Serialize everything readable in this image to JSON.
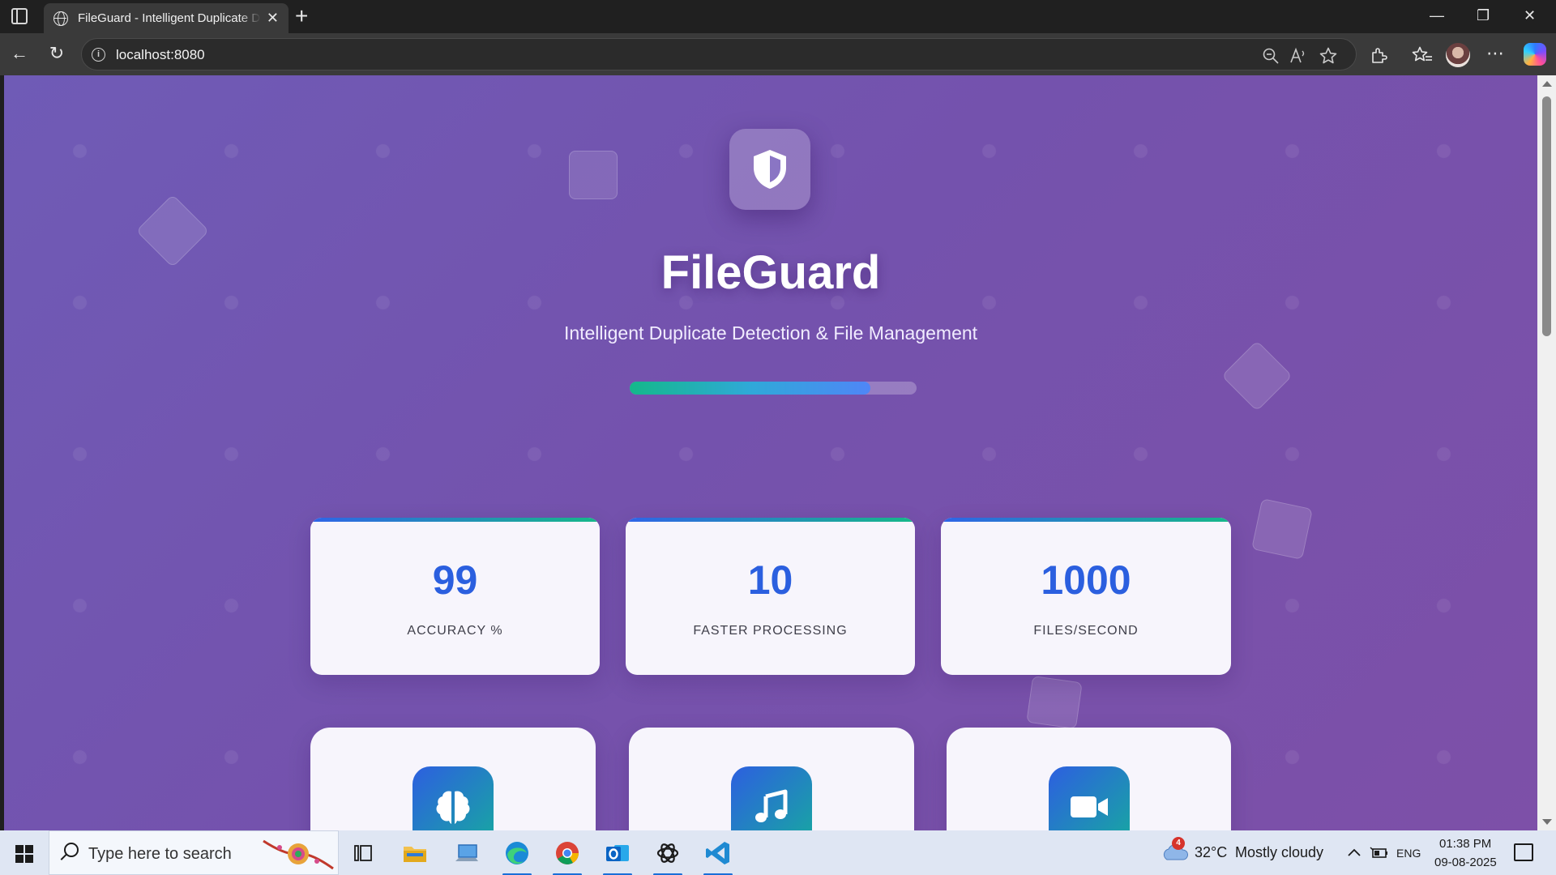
{
  "browser": {
    "tab_title": "FileGuard - Intelligent Duplicate Detection & File Management",
    "tab_close": "✕",
    "new_tab": "+",
    "url": "localhost:8080",
    "window_controls": {
      "minimize": "—",
      "restore": "❐",
      "close": "✕"
    },
    "nav": {
      "back": "←",
      "refresh": "↻",
      "favorites": "☆",
      "more": "⋯"
    }
  },
  "hero": {
    "icon": "shield-icon",
    "title": "FileGuard",
    "subtitle": "Intelligent Duplicate Detection & File Management",
    "progress_percent": 84
  },
  "stats": [
    {
      "value": "99",
      "label": "ACCURACY %"
    },
    {
      "value": "10",
      "label": "FASTER PROCESSING"
    },
    {
      "value": "1000",
      "label": "FILES/SECOND"
    }
  ],
  "features": [
    {
      "icon": "brain-icon"
    },
    {
      "icon": "music-note-icon"
    },
    {
      "icon": "video-camera-icon"
    }
  ],
  "taskbar": {
    "search_placeholder": "Type here to search",
    "weather_badge": "4",
    "temperature": "32°C",
    "weather": "Mostly cloudy",
    "language": "ENG",
    "time": "01:38 PM",
    "date": "09-08-2025"
  },
  "colors": {
    "background_start": "#6f5bb6",
    "background_end": "#7d50a8",
    "accent_blue": "#2b5fdf",
    "accent_green": "#16b889",
    "card": "#f7f5fc"
  }
}
